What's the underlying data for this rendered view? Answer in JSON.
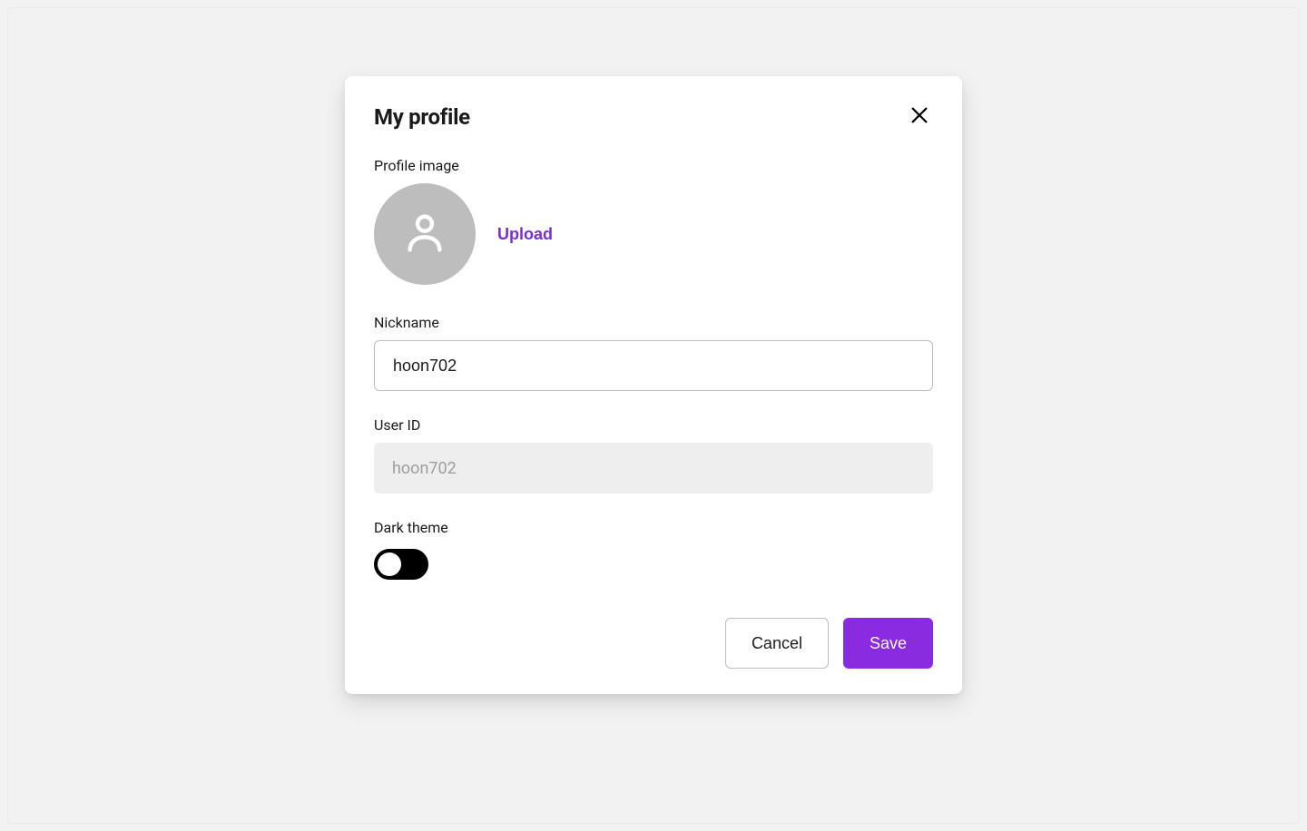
{
  "modal": {
    "title": "My profile",
    "profile_image": {
      "label": "Profile image",
      "upload_label": "Upload"
    },
    "nickname": {
      "label": "Nickname",
      "value": "hoon702"
    },
    "user_id": {
      "label": "User ID",
      "value": "hoon702"
    },
    "dark_theme": {
      "label": "Dark theme",
      "enabled": false
    },
    "actions": {
      "cancel_label": "Cancel",
      "save_label": "Save"
    }
  },
  "colors": {
    "accent": "#8a2be2",
    "upload_link": "#7c2cd6"
  }
}
